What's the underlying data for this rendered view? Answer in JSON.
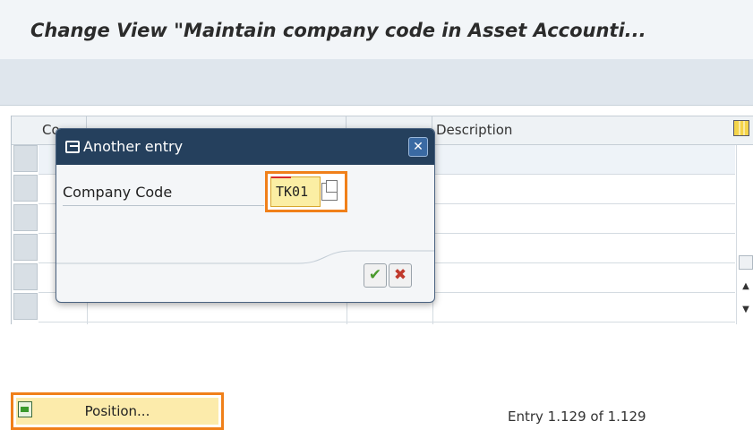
{
  "window": {
    "title": "Change View \"Maintain company code in Asset Accounti..."
  },
  "table": {
    "columns": [
      "Co",
      "",
      "",
      "Description"
    ],
    "row_count": 6
  },
  "dialog": {
    "title": "Another entry",
    "close_label": "✕",
    "field_label": "Company Code",
    "field_value": "TK01",
    "ok_label": "✔",
    "cancel_label": "✖"
  },
  "footer": {
    "position_button_label": "Position...",
    "entry_text": "Entry 1.129 of 1.129"
  },
  "icons": {
    "dialog_title_icon": "new-window-icon",
    "close": "close-icon",
    "value_help": "value-help-icon",
    "ok": "checkmark-icon",
    "cancel": "cancel-x-icon",
    "position": "position-icon",
    "column_settings": "table-settings-icon",
    "scroll_up": "arrow-up-icon",
    "scroll_down": "arrow-down-icon"
  },
  "colors": {
    "title_bar_dialog": "#25405d",
    "highlight_orange": "#f0801a",
    "input_yellow": "#fbeea4"
  }
}
